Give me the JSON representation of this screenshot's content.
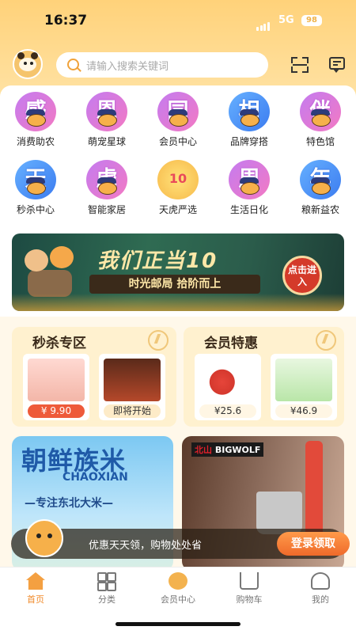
{
  "status": {
    "time": "16:37",
    "network": "5G",
    "battery": "98"
  },
  "search": {
    "placeholder": "请输入搜索关键词"
  },
  "categories": [
    {
      "char": "感",
      "label": "消费助农"
    },
    {
      "char": "恩",
      "label": "萌宠星球"
    },
    {
      "char": "同",
      "label": "会员中心"
    },
    {
      "char": "相",
      "label": "品牌穿搭"
    },
    {
      "char": "伴",
      "label": "特色馆"
    },
    {
      "char": "天",
      "label": "秒杀中心"
    },
    {
      "char": "虎",
      "label": "智能家居"
    },
    {
      "char": "10",
      "label": "天虎严选"
    },
    {
      "char": "周",
      "label": "生活日化"
    },
    {
      "char": "年",
      "label": "粮新益农"
    }
  ],
  "banner": {
    "title": "我们正当10",
    "subtitle": "时光邮局  拾阶而上",
    "button": "点击进入"
  },
  "flash_sale": {
    "title": "秒杀专区",
    "items": [
      {
        "price": "¥ 9.90"
      },
      {
        "price": "即将开始"
      }
    ]
  },
  "member": {
    "title": "会员特惠",
    "items": [
      {
        "price": "¥25.6"
      },
      {
        "price": "¥46.9"
      }
    ]
  },
  "promo_left": {
    "headline": "朝鲜族米",
    "pinyin": "CHAOXIAN",
    "slogan": "—专注东北大米—"
  },
  "promo_right": {
    "brand_a": "北山",
    "brand_b": "BIGWOLF"
  },
  "toast": {
    "text": "优惠天天领，购物处处省",
    "button": "登录领取"
  },
  "tabs": [
    {
      "label": "首页"
    },
    {
      "label": "分类"
    },
    {
      "label": "会员中心"
    },
    {
      "label": "购物车"
    },
    {
      "label": "我的"
    }
  ]
}
